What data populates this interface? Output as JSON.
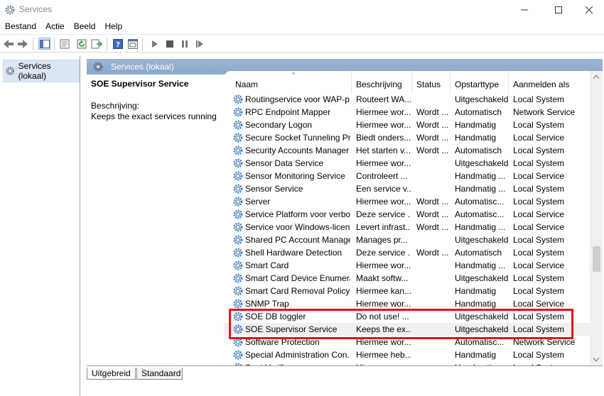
{
  "window": {
    "title": "Services"
  },
  "menu": [
    {
      "label": "Bestand",
      "key": "B"
    },
    {
      "label": "Actie",
      "key": "A"
    },
    {
      "label": "Beeld",
      "key": "B"
    },
    {
      "label": "Help",
      "key": "H"
    }
  ],
  "tree": {
    "root": "Services (lokaal)"
  },
  "panel": {
    "title": "Services (lokaal)"
  },
  "description": {
    "service_name": "SOE Supervisor Service",
    "label": "Beschrijving:",
    "text": "Keeps the exact services running"
  },
  "columns": [
    "Naam",
    "Beschrijving",
    "Status",
    "Opstarttype",
    "Aanmelden als"
  ],
  "rows": [
    [
      "Routingservice voor WAP-p...",
      "Routeert WA...",
      "",
      "Uitgeschakeld",
      "Local System"
    ],
    [
      "RPC Endpoint Mapper",
      "Hiermee wor...",
      "Wordt ...",
      "Automatisch",
      "Network Service"
    ],
    [
      "Secondary Logon",
      "Hiermee wor...",
      "Wordt ...",
      "Handmatig",
      "Local System"
    ],
    [
      "Secure Socket Tunneling Pr...",
      "Biedt onders...",
      "Wordt ...",
      "Handmatig",
      "Local Service"
    ],
    [
      "Security Accounts Manager",
      "Het starten v...",
      "Wordt ...",
      "Automatisch",
      "Local System"
    ],
    [
      "Sensor Data Service",
      "Hiermee wor...",
      "",
      "Uitgeschakeld",
      "Local System"
    ],
    [
      "Sensor Monitoring Service",
      "Controleert ...",
      "",
      "Handmatig ...",
      "Local Service"
    ],
    [
      "Sensor Service",
      "Een service v...",
      "",
      "Handmatig ...",
      "Local System"
    ],
    [
      "Server",
      "Hiermee wor...",
      "Wordt ...",
      "Automatisc...",
      "Local System"
    ],
    [
      "Service Platform voor verbo...",
      "Deze service ...",
      "Wordt ...",
      "Automatisc...",
      "Local Service"
    ],
    [
      "Service voor Windows-licen...",
      "Levert infrast...",
      "Wordt ...",
      "Handmatig ...",
      "Local Service"
    ],
    [
      "Shared PC Account Manager",
      "Manages pr...",
      "",
      "Uitgeschakeld",
      "Local System"
    ],
    [
      "Shell Hardware Detection",
      "Deze service ...",
      "Wordt ...",
      "Automatisch",
      "Local System"
    ],
    [
      "Smart Card",
      "Hiermee wor...",
      "",
      "Handmatig ...",
      "Local Service"
    ],
    [
      "Smart Card Device Enumera...",
      "Maakt softw...",
      "",
      "Uitgeschakeld",
      "Local System"
    ],
    [
      "Smart Card Removal Policy",
      "Hiermee kan...",
      "",
      "Handmatig",
      "Local System"
    ],
    [
      "SNMP Trap",
      "Hiermee wor...",
      "",
      "Handmatig",
      "Local Service"
    ],
    [
      "SOE DB toggler",
      "Do not use! ...",
      "",
      "Uitgeschakeld",
      "Local System"
    ],
    [
      "SOE Supervisor Service",
      "Keeps the ex...",
      "",
      "Uitgeschakeld",
      "Local System"
    ],
    [
      "Software Protection",
      "Hiermee wor...",
      "",
      "Automatisc...",
      "Network Service"
    ],
    [
      "Special Administration Con...",
      "Hiermee heb...",
      "",
      "Handmatig",
      "Local System"
    ],
    [
      "Spot Verifier",
      "Hiermee ...",
      "",
      "Handmatig ...",
      "Local System"
    ]
  ],
  "selected_row": 18,
  "tabs": [
    "Uitgebreid",
    "Standaard"
  ],
  "colors": {
    "highlight": "#e0141e",
    "header_band": "#9cb5d3"
  }
}
